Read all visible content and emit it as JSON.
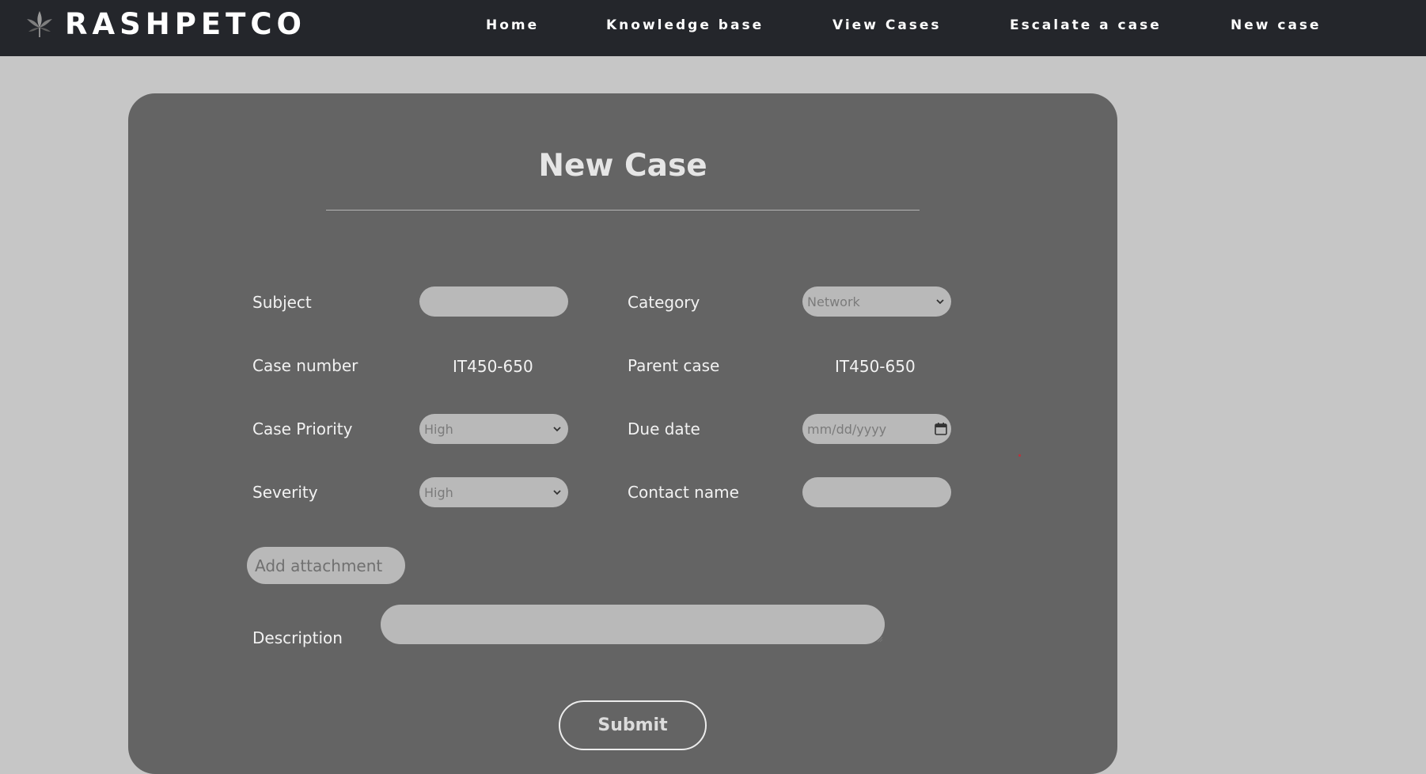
{
  "brand": {
    "name": "RASHPETCO",
    "logo_icon": "flame-leaf-icon"
  },
  "nav": {
    "links": [
      {
        "label": "Home"
      },
      {
        "label": "Knowledge base"
      },
      {
        "label": "View Cases"
      },
      {
        "label": "Escalate a case"
      },
      {
        "label": "New case"
      }
    ]
  },
  "form": {
    "title": "New Case",
    "subject": {
      "label": "Subject",
      "value": ""
    },
    "category": {
      "label": "Category",
      "selected": "Network"
    },
    "case_number": {
      "label": "Case number",
      "value": "IT450-650"
    },
    "parent_case": {
      "label": "Parent case",
      "value": "IT450-650"
    },
    "case_priority": {
      "label": "Case Priority",
      "selected": "High"
    },
    "due_date": {
      "label": "Due date",
      "placeholder": "mm/dd/yyyy",
      "icon": "calendar-icon"
    },
    "severity": {
      "label": "Severity",
      "selected": "High"
    },
    "contact_name": {
      "label": "Contact name",
      "value": ""
    },
    "attachment": {
      "label": "Add attachment"
    },
    "description": {
      "label": "Description",
      "value": ""
    },
    "submit": {
      "label": "Submit"
    }
  },
  "colors": {
    "navbar": "#24262b",
    "page_background": "#c6c6c6",
    "card": "#646464",
    "field": "#b9b9b9"
  }
}
